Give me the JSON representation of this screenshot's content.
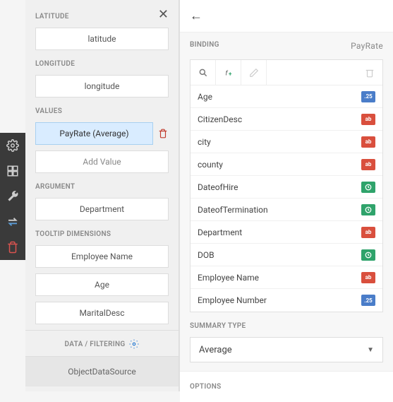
{
  "toolbar": {
    "items": [
      "gear",
      "layout",
      "wrench",
      "swap",
      "trash"
    ]
  },
  "panel": {
    "sections": {
      "latitude": {
        "header": "LATITUDE",
        "value": "latitude"
      },
      "longitude": {
        "header": "LONGITUDE",
        "value": "longitude"
      },
      "values": {
        "header": "VALUES",
        "selected": "PayRate (Average)",
        "add_label": "Add Value"
      },
      "argument": {
        "header": "ARGUMENT",
        "value": "Department"
      },
      "tooltip": {
        "header": "TOOLTIP DIMENSIONS",
        "items": [
          "Employee Name",
          "Age",
          "MaritalDesc"
        ]
      }
    },
    "footer": "DATA / FILTERING",
    "datasource": "ObjectDataSource"
  },
  "binding": {
    "header": "BINDING",
    "bound_to": "PayRate",
    "fields": [
      {
        "name": "Age",
        "type": "num"
      },
      {
        "name": "CitizenDesc",
        "type": "txt"
      },
      {
        "name": "city",
        "type": "txt"
      },
      {
        "name": "county",
        "type": "txt"
      },
      {
        "name": "DateofHire",
        "type": "date"
      },
      {
        "name": "DateofTermination",
        "type": "date"
      },
      {
        "name": "Department",
        "type": "txt"
      },
      {
        "name": "DOB",
        "type": "date"
      },
      {
        "name": "Employee Name",
        "type": "txt"
      },
      {
        "name": "Employee Number",
        "type": "num"
      }
    ],
    "summary_header": "SUMMARY TYPE",
    "summary_value": "Average",
    "options_header": "OPTIONS"
  }
}
